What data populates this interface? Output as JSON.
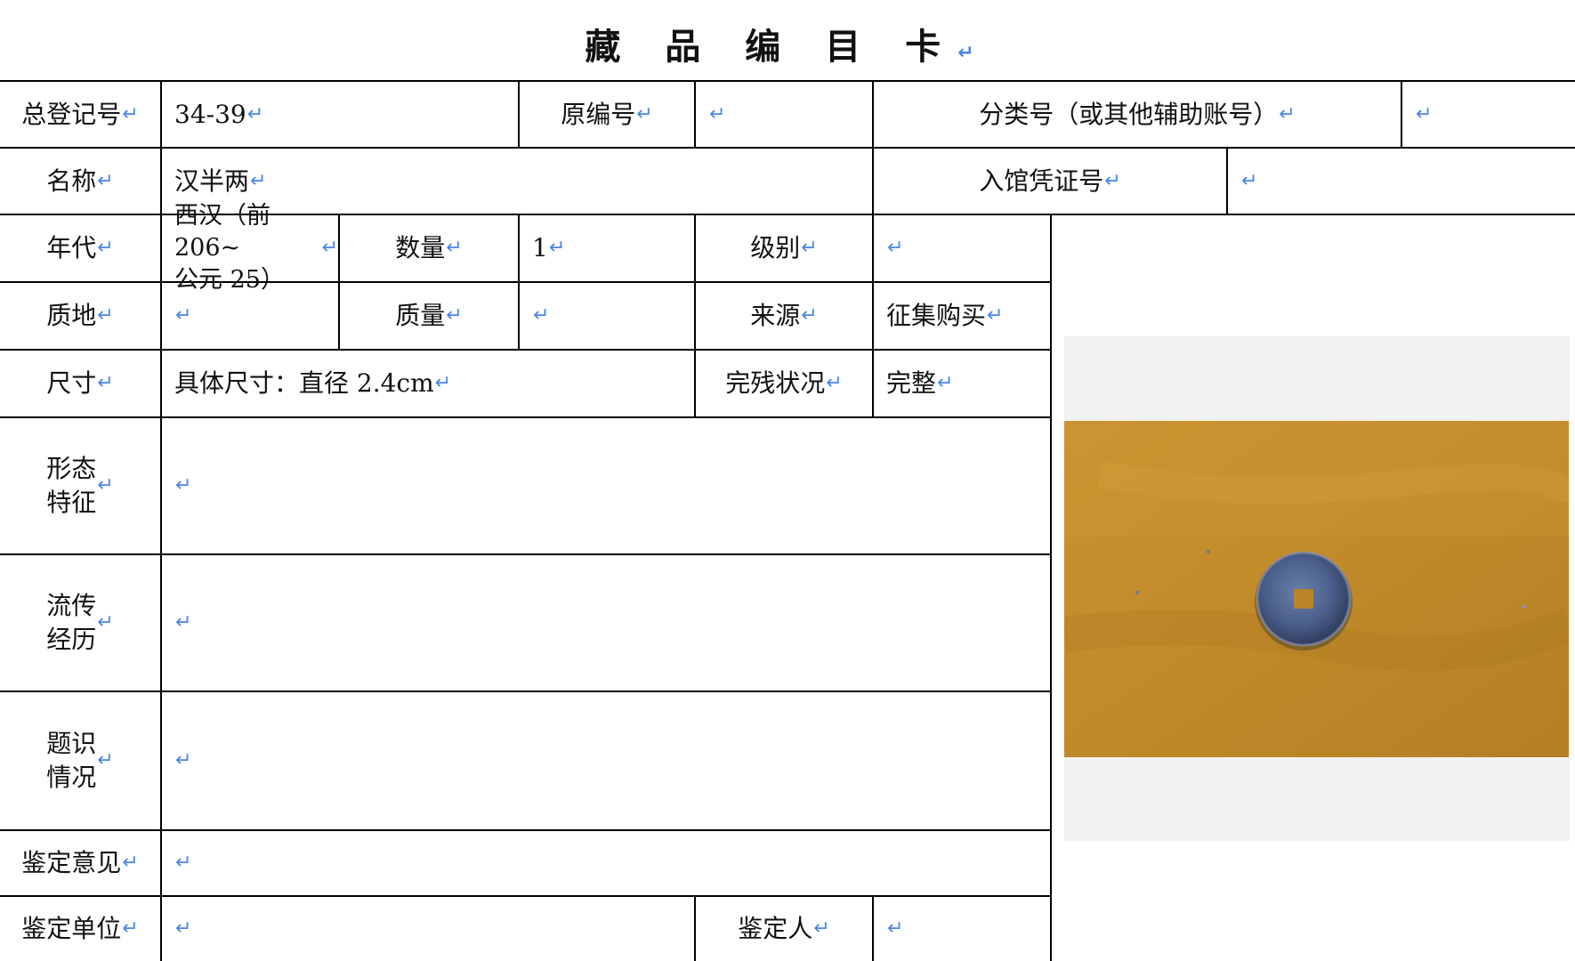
{
  "title": "藏 品 编 目 卡",
  "pilcrow": "↵",
  "card": {
    "registration_no_label": "总登记号",
    "registration_no": "34-39",
    "original_no_label": "原编号",
    "original_no": "",
    "class_no_label": "分类号（或其他辅助账号）",
    "class_no": "",
    "name_label": "名称",
    "name": "汉半两",
    "voucher_label": "入馆凭证号",
    "voucher": "",
    "era_label": "年代",
    "era": "西汉（前 206~\n公元 25）",
    "quantity_label": "数量",
    "quantity": "1",
    "grade_label": "级别",
    "grade": "",
    "material_label": "质地",
    "material": "",
    "mass_label": "质量",
    "mass": "",
    "source_label": "来源",
    "source": "征集购买",
    "size_label": "尺寸",
    "size": "具体尺寸：直径 2.4cm",
    "condition_label": "完残状况",
    "condition": "完整",
    "form_label": "形态\n特征",
    "form": "",
    "history_label": "流传\n经历",
    "history": "",
    "inscription_label": "题识\n情况",
    "inscription": "",
    "opinion_label": "鉴定意见",
    "opinion": "",
    "unit_label": "鉴定单位",
    "unit": "",
    "appraiser_label": "鉴定人",
    "appraiser": ""
  },
  "colors": {
    "border": "#000000",
    "pilcrow": "#4a86e8",
    "cloth": "#c48e2a",
    "coin": "#4b5f8c"
  },
  "photo": {
    "icon": "coin-photo"
  }
}
